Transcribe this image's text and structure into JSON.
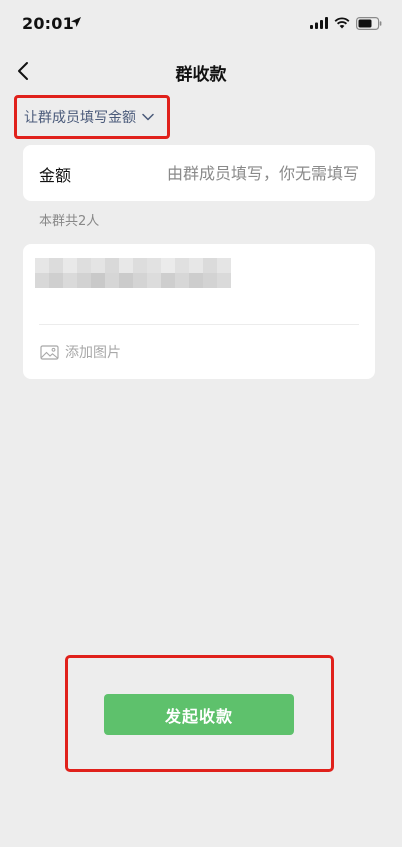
{
  "status_bar": {
    "time": "20:01",
    "icons": [
      "location-arrow-icon",
      "signal-icon",
      "wifi-icon",
      "battery-icon"
    ]
  },
  "nav": {
    "title": "群收款",
    "back_icon": "chevron-left-icon"
  },
  "mode_selector": {
    "label": "让群成员填写金额",
    "icon": "chevron-down-icon"
  },
  "amount": {
    "label": "金额",
    "placeholder": "由群成员填写，你无需填写"
  },
  "member_count": "本群共2人",
  "note": {
    "add_image_label": "添加图片",
    "add_image_icon": "image-icon"
  },
  "submit": {
    "label": "发起收款"
  },
  "colors": {
    "background": "#ededed",
    "accent_green": "#5ec16c",
    "highlight_red": "#e0211b",
    "link_blue": "#4a5a7a"
  }
}
